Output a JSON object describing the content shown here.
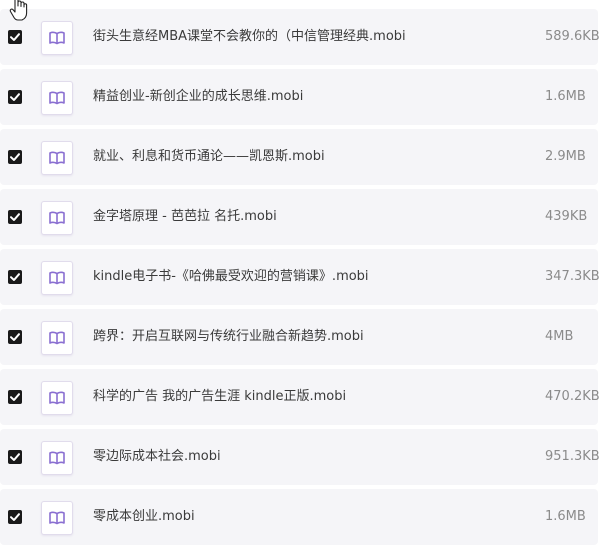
{
  "files": [
    {
      "name": "街头生意经MBA课堂不会教你的（中信管理经典.mobi",
      "size": "589.6KB",
      "checked": true,
      "icon": "book-icon"
    },
    {
      "name": "精益创业-新创企业的成长思维.mobi",
      "size": "1.6MB",
      "checked": true,
      "icon": "book-icon"
    },
    {
      "name": "就业、利息和货币通论——凯恩斯.mobi",
      "size": "2.9MB",
      "checked": true,
      "icon": "book-icon"
    },
    {
      "name": "金字塔原理 - 芭芭拉 名托.mobi",
      "size": "439KB",
      "checked": true,
      "icon": "book-icon"
    },
    {
      "name": "kindle电子书-《哈佛最受欢迎的营销课》.mobi",
      "size": "347.3KB",
      "checked": true,
      "icon": "book-icon"
    },
    {
      "name": "跨界：开启互联网与传统行业融合新趋势.mobi",
      "size": "4MB",
      "checked": true,
      "icon": "book-icon"
    },
    {
      "name": "科学的广告 我的广告生涯 kindle正版.mobi",
      "size": "470.2KB",
      "checked": true,
      "icon": "book-icon"
    },
    {
      "name": "零边际成本社会.mobi",
      "size": "951.3KB",
      "checked": true,
      "icon": "book-icon"
    },
    {
      "name": "零成本创业.mobi",
      "size": "1.6MB",
      "checked": true,
      "icon": "book-icon"
    }
  ],
  "colors": {
    "row_background": "#f5f5f8",
    "checkbox": "#1a1a1a",
    "icon_accent": "#8a6fd1"
  }
}
